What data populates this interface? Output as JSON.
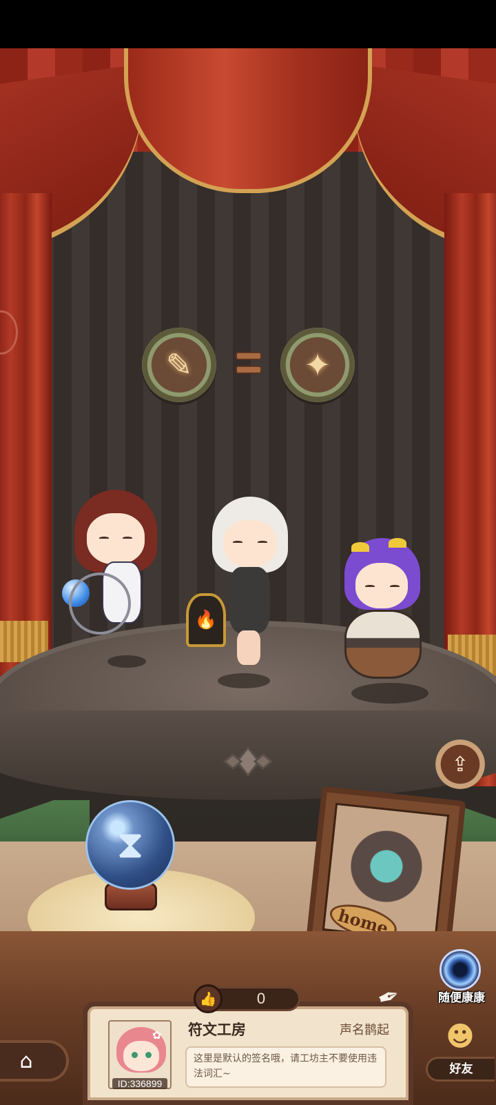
{
  "scene": {
    "emblems": {
      "left_icon": "scroll-check-icon",
      "right_icon": "sparkle-figure-icon"
    }
  },
  "counter": {
    "value": "0",
    "icon": "thumbs-up-icon"
  },
  "random_visit": {
    "label": "随便康康",
    "icon": "portal-icon"
  },
  "home_frame": {
    "label": "home"
  },
  "workshop": {
    "name": "符文工房",
    "reputation": "声名鹊起",
    "signature": "这里是默认的签名哦，请工坊主不要使用违法词汇~",
    "player_id": "ID:336899"
  },
  "nav": {
    "home_icon": "house-icon",
    "friends_label": "好友",
    "share_icon": "share-icon"
  },
  "colors": {
    "curtain": "#b23a26",
    "trim_gold": "#d4a253",
    "panel_bg": "#f2e3cc",
    "wood_dark": "#4a2c1f"
  }
}
